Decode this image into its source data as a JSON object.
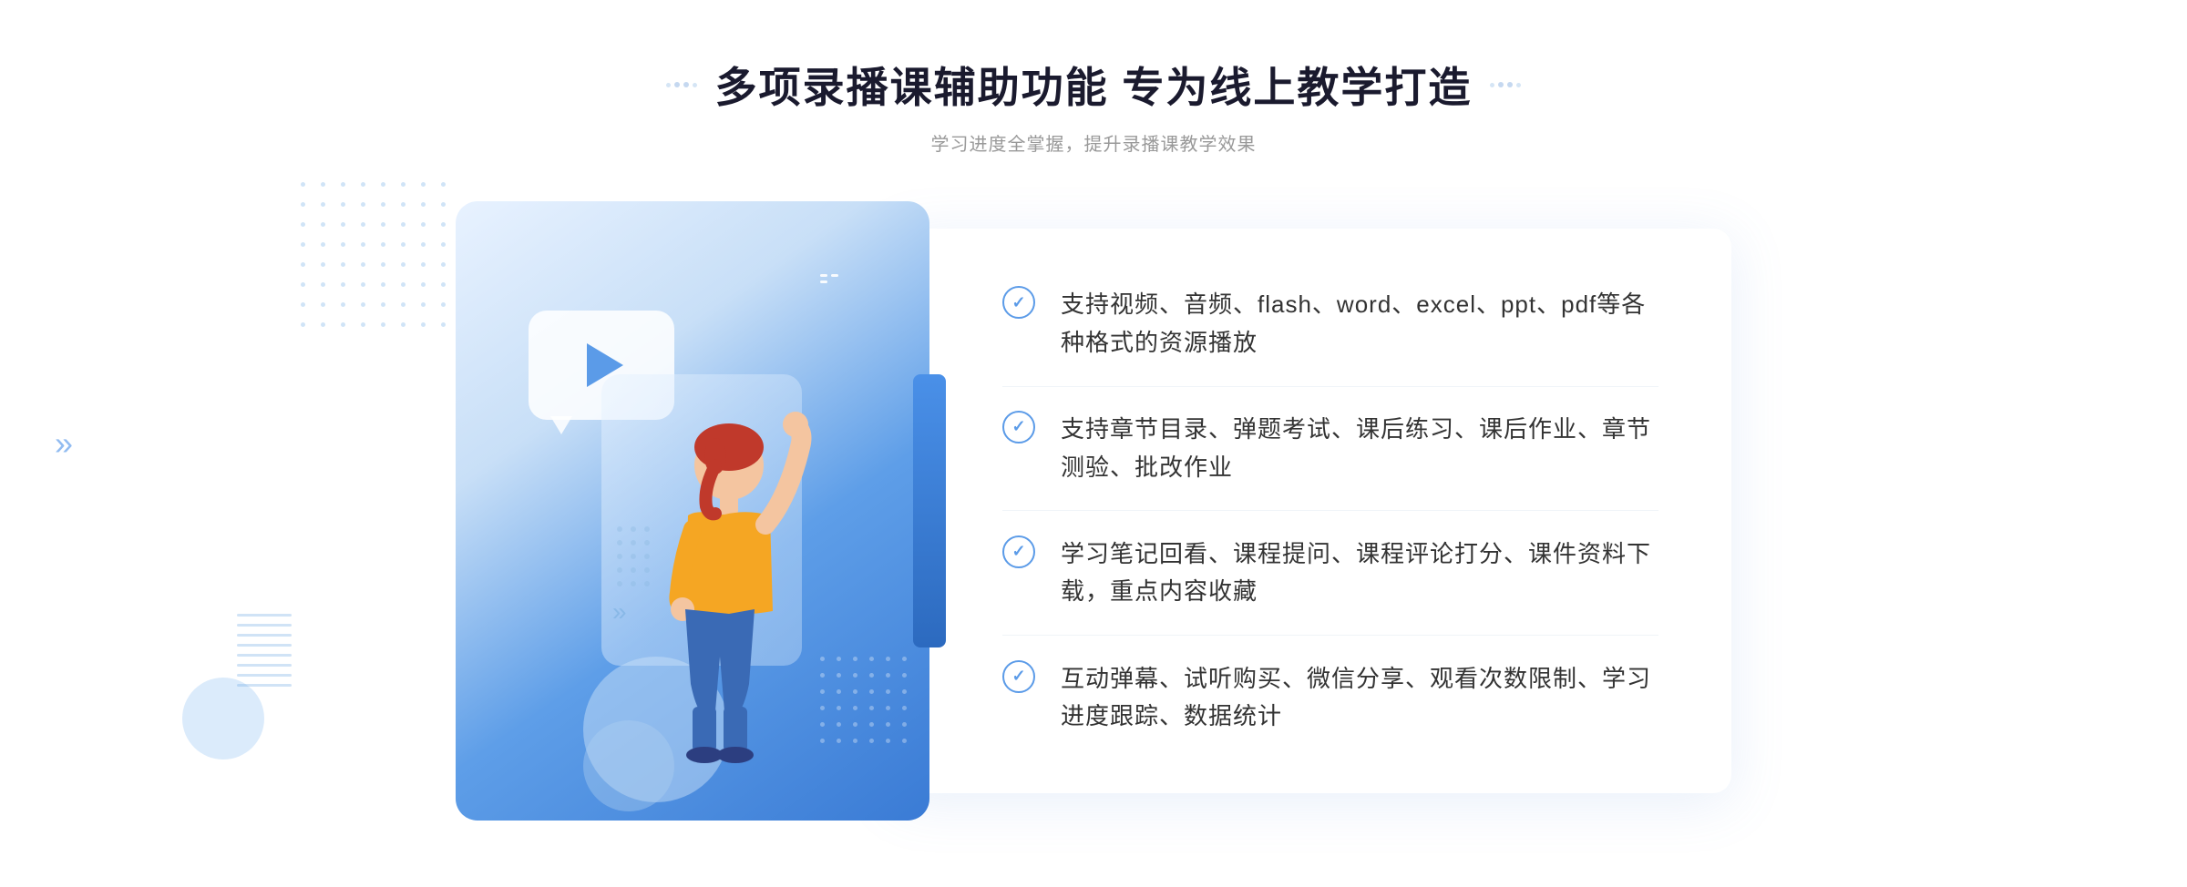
{
  "page": {
    "background": "#ffffff"
  },
  "header": {
    "title": "多项录播课辅助功能 专为线上教学打造",
    "subtitle": "学习进度全掌握，提升录播课教学效果",
    "decorator_left": "❖",
    "decorator_right": "❖"
  },
  "features": [
    {
      "id": 1,
      "text": "支持视频、音频、flash、word、excel、ppt、pdf等各种格式的资源播放"
    },
    {
      "id": 2,
      "text": "支持章节目录、弹题考试、课后练习、课后作业、章节测验、批改作业"
    },
    {
      "id": 3,
      "text": "学习笔记回看、课程提问、课程评论打分、课件资料下载，重点内容收藏"
    },
    {
      "id": 4,
      "text": "互动弹幕、试听购买、微信分享、观看次数限制、学习进度跟踪、数据统计"
    }
  ],
  "illustration": {
    "alt": "教师指导学生插图"
  },
  "colors": {
    "primary": "#4a90e8",
    "accent": "#3a7bd5",
    "text_main": "#1a1a2e",
    "text_sub": "#999999",
    "text_feature": "#333333",
    "check_color": "#5b9be8"
  }
}
